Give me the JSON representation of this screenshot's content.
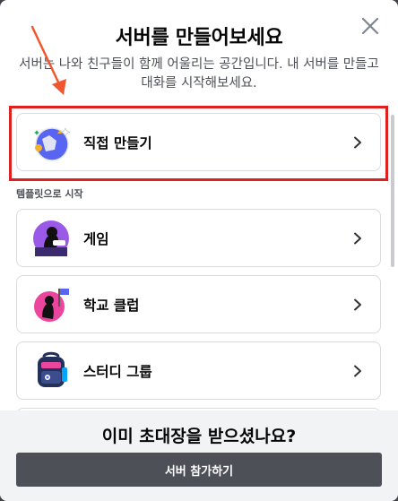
{
  "header": {
    "title": "서버를 만들어보세요",
    "subtitle": "서버는 나와 친구들이 함께 어울리는 공간입니다. 내 서버를 만들고 대화를 시작해보세요."
  },
  "create_option": {
    "label": "직접 만들기",
    "icon": "globe-sparkle-icon"
  },
  "templates": {
    "section_label": "템플릿으로 시작",
    "items": [
      {
        "label": "게임",
        "icon": "gaming-character-icon"
      },
      {
        "label": "학교 클럽",
        "icon": "school-club-icon"
      },
      {
        "label": "스터디 그룹",
        "icon": "backpack-icon"
      }
    ]
  },
  "footer": {
    "question": "이미 초대장을 받으셨나요?",
    "join_button": "서버 참가하기"
  },
  "colors": {
    "highlight": "#e0201d",
    "button": "#4e5058",
    "footer_bg": "#f2f3f5"
  }
}
